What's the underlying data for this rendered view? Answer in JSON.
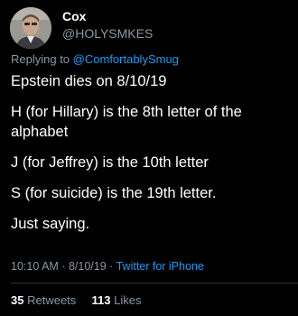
{
  "user": {
    "display_name": "Cox",
    "handle": "@HOLYSMKES"
  },
  "reply": {
    "prefix": "Replying to",
    "mention": "@ComfortablySmug"
  },
  "tweet": {
    "lines": [
      "Epstein dies on 8/10/19",
      "H (for Hillary) is the 8th letter of the alphabet",
      "J (for Jeffrey) is the 10th letter",
      "S (for suicide) is the 19th letter.",
      "Just saying."
    ]
  },
  "meta": {
    "time": "10:10 AM",
    "separator": "·",
    "date": "8/10/19",
    "source": "Twitter for iPhone"
  },
  "stats": {
    "retweets_count": "35",
    "retweets_label": "Retweets",
    "likes_count": "113",
    "likes_label": "Likes"
  },
  "colors": {
    "background": "#000000",
    "text": "#ffffff",
    "secondary": "#8b98a5",
    "accent": "#1d9bf0",
    "divider": "#2f3336"
  }
}
